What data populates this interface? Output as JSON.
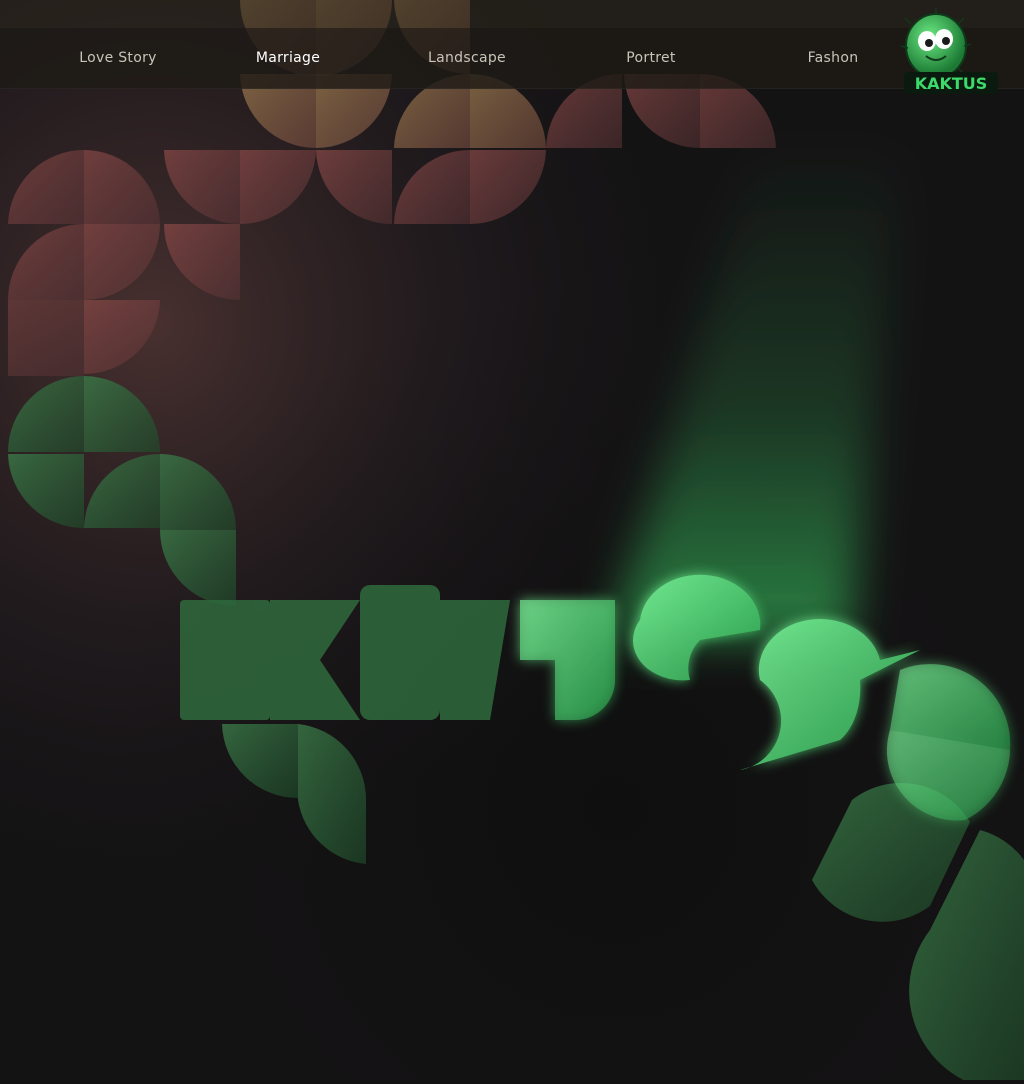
{
  "nav": {
    "items": [
      {
        "label": "Love Story",
        "active": false
      },
      {
        "label": "Marriage",
        "active": true
      },
      {
        "label": "Landscape",
        "active": false
      },
      {
        "label": "Portret",
        "active": false
      },
      {
        "label": "Fashon",
        "active": false
      }
    ]
  },
  "logo": {
    "text": "KAKTUS",
    "icon": "cactus-mascot-icon"
  },
  "hero": {
    "wordmark": "KAKTUS",
    "icon": "kaktus-glow-wordmark"
  },
  "colors": {
    "background": "#141314",
    "nav_bg": "#1e1b16",
    "nav_text": "#c9c4b8",
    "nav_text_active": "#ffffff",
    "accent_green": "#3dd96a",
    "warm_tile": "#8a6a4a",
    "rose_tile": "#8a4848",
    "green_tile": "#2f6a3c"
  }
}
